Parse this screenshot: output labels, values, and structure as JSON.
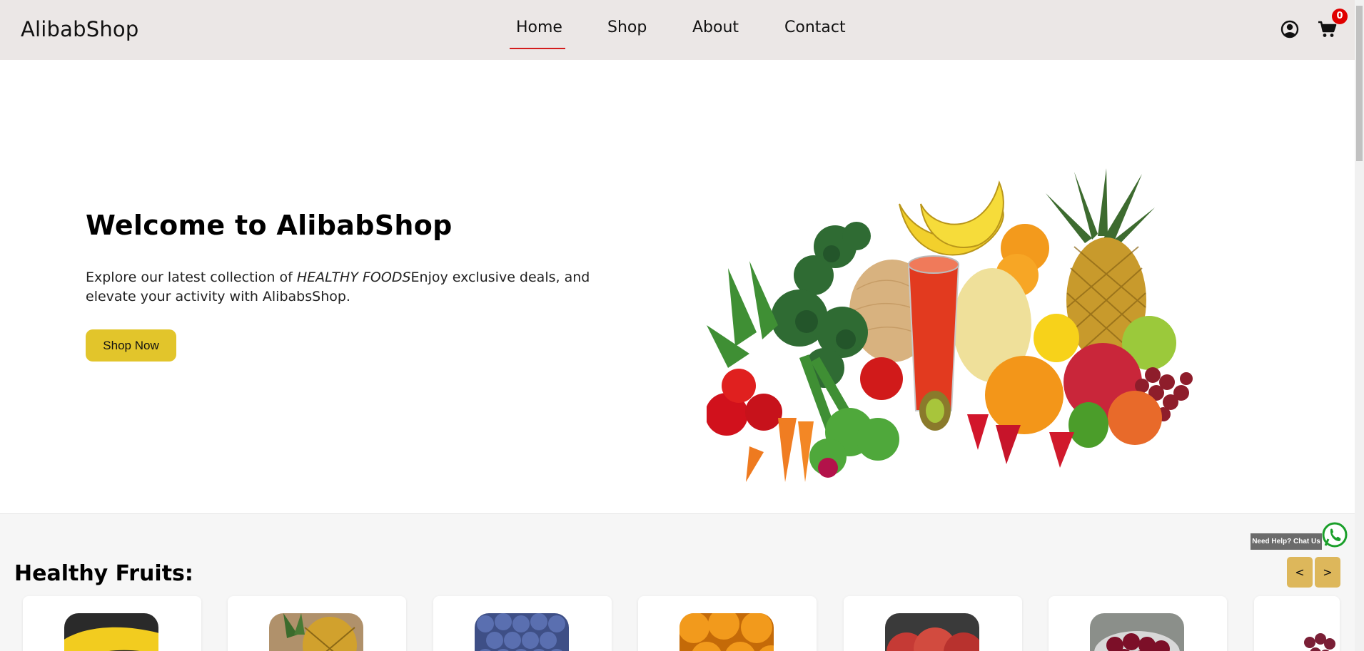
{
  "header": {
    "brand": "AlibabShop",
    "nav": [
      "Home",
      "Shop",
      "About",
      "Contact"
    ],
    "active_nav": "Home",
    "cart_count": "0",
    "icons": [
      "user-icon",
      "cart-icon"
    ]
  },
  "hero": {
    "title": "Welcome to AlibabShop",
    "text_before": "Explore our latest collection of ",
    "text_em": "HEALTHY FOODS",
    "text_after": "Enjoy exclusive deals, and elevate your activity with AlibabsShop.",
    "button": "Shop Now"
  },
  "section": {
    "title": "Healthy Fruits:",
    "prev": "<",
    "next": ">"
  },
  "products": [
    "banana",
    "pineapple",
    "blueberry",
    "orange",
    "apple",
    "cherry",
    "grape"
  ],
  "chat": {
    "label": "Need Help? Chat Us",
    "icon": "whatsapp-icon"
  },
  "colors": {
    "header_bg": "#ebe7e6",
    "accent_underline": "#d31d1d",
    "button_yellow": "#e2c52b",
    "arrow_gold": "#ddb75b",
    "badge_red": "#e00000",
    "whatsapp_green": "#1a9f2a"
  }
}
